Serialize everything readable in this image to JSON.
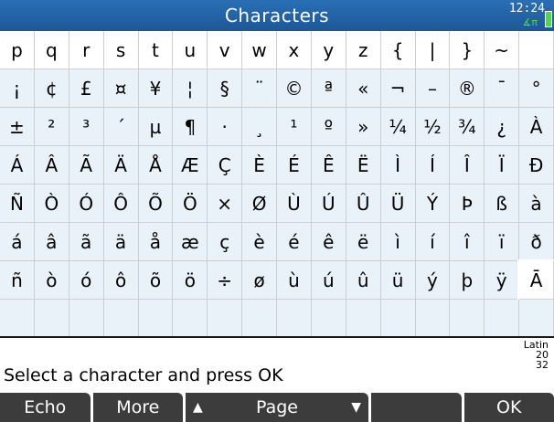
{
  "title_bar": {
    "title": "Characters",
    "time": "12:24",
    "angle_mode": "∡π",
    "colors": {
      "background": "#2a6fb6",
      "text": "#ffffff",
      "accent": "#4cd84c"
    }
  },
  "grid": {
    "rows": [
      [
        "p",
        "q",
        "r",
        "s",
        "t",
        "u",
        "v",
        "w",
        "x",
        "y",
        "z",
        "{",
        "|",
        "}",
        "~",
        ""
      ],
      [
        "¡",
        "¢",
        "£",
        "¤",
        "¥",
        "¦",
        "§",
        "¨",
        "©",
        "ª",
        "«",
        "¬",
        "–",
        "®",
        "¯",
        "°"
      ],
      [
        "±",
        "²",
        "³",
        "´",
        "µ",
        "¶",
        "·",
        "¸",
        "¹",
        "º",
        "»",
        "¼",
        "½",
        "¾",
        "¿",
        "À"
      ],
      [
        "Á",
        "Â",
        "Ã",
        "Ä",
        "Å",
        "Æ",
        "Ç",
        "È",
        "É",
        "Ê",
        "Ë",
        "Ì",
        "Í",
        "Î",
        "Ï",
        "Ð"
      ],
      [
        "Ñ",
        "Ò",
        "Ó",
        "Ô",
        "Õ",
        "Ö",
        "×",
        "Ø",
        "Ù",
        "Ú",
        "Û",
        "Ü",
        "Ý",
        "Þ",
        "ß",
        "à"
      ],
      [
        "á",
        "â",
        "ã",
        "ä",
        "å",
        "æ",
        "ç",
        "è",
        "é",
        "ê",
        "ë",
        "ì",
        "í",
        "î",
        "ï",
        "ð"
      ],
      [
        "ñ",
        "ò",
        "ó",
        "ô",
        "õ",
        "ö",
        "÷",
        "ø",
        "ù",
        "ú",
        "û",
        "ü",
        "ý",
        "þ",
        "ÿ",
        "Ā"
      ],
      [
        "",
        "",
        "",
        "",
        "",
        "",
        "",
        "",
        "",
        "",
        "",
        "",
        "",
        "",
        "",
        ""
      ]
    ],
    "selected_character": "Ā",
    "colors": {
      "cell_background": "#e9f2f9",
      "selected_background": "#ffffff"
    }
  },
  "footer": {
    "hint": "Select a character and press OK",
    "char_set": "Latin",
    "code_line_1": "20",
    "code_line_2": "32"
  },
  "softkeys": [
    {
      "label": "Echo"
    },
    {
      "label": "More"
    },
    {
      "label": "Page",
      "left_arrow": "▲",
      "right_arrow": "▼"
    },
    {
      "label": ""
    },
    {
      "label": "OK"
    }
  ]
}
